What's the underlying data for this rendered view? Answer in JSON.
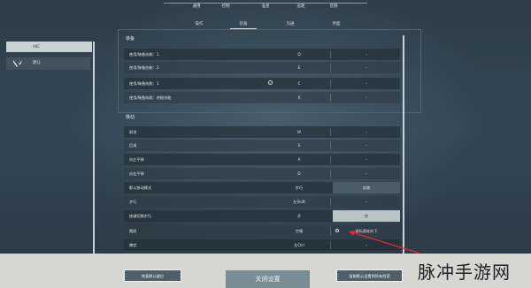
{
  "top_tabs": [
    "通用",
    "控制",
    "准星",
    "远距",
    "音频"
  ],
  "sub_tabs": [
    "操作",
    "装备",
    "沟通",
    "界面"
  ],
  "left_panel": {
    "selected_label": "ABC",
    "item_label": "默认"
  },
  "sections": {
    "equipment_title": "装备",
    "movement_title": "移动"
  },
  "equipment_rows": [
    {
      "label": "使用/装备技能：1",
      "key1": "Q",
      "key2": "-"
    },
    {
      "label": "使用/装备技能：2",
      "key1": "E",
      "key2": "-"
    },
    {
      "label": "使用/装备技能：3",
      "key1": "C",
      "key2": "-"
    },
    {
      "label": "使用/装备技能：终极技能",
      "key1": "X",
      "key2": "-"
    }
  ],
  "movement_rows": [
    {
      "label": "前进",
      "key1": "W",
      "key2": "-"
    },
    {
      "label": "后退",
      "key1": "S",
      "key2": "-"
    },
    {
      "label": "向左平移",
      "key1": "A",
      "key2": "-"
    },
    {
      "label": "向右平移",
      "key1": "D",
      "key2": "-"
    },
    {
      "label": "默认移动模式",
      "key1": "步行",
      "key2": "奔跑"
    },
    {
      "label": "步行",
      "key1": "左Shift",
      "key2": "-"
    },
    {
      "label": "按键切换步行",
      "key1": "开",
      "key2": "关"
    },
    {
      "label": "跳跃",
      "key1": "空格",
      "key2": "鼠标滚轮向下"
    },
    {
      "label": "蹲伏",
      "key1": "左Ctrl",
      "key2": "-"
    }
  ],
  "footer": {
    "left_button": "恢复默认键位",
    "main_button": "关闭设置",
    "right_button": "复制默认设置到所有档案"
  },
  "watermark": "脉冲手游网",
  "colors": {
    "highlight": "#e0263a",
    "background": "#2e3d48"
  }
}
